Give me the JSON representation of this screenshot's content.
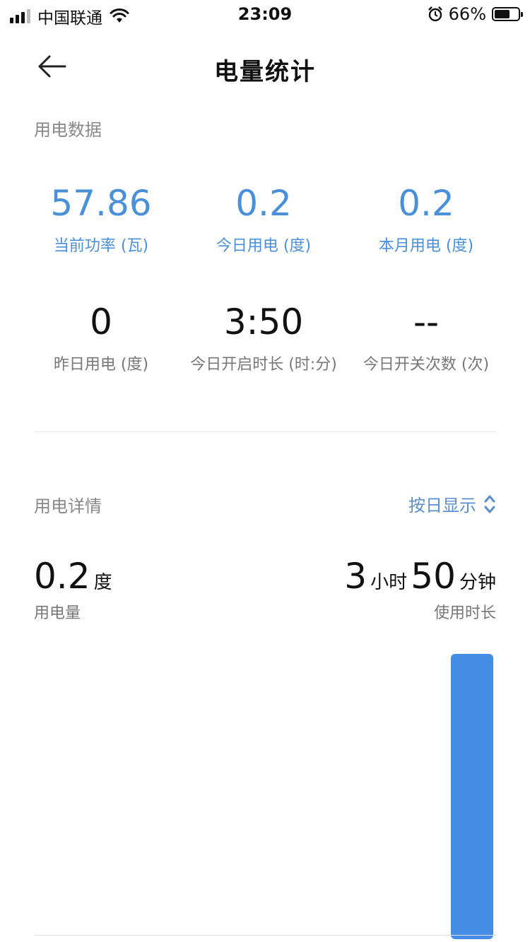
{
  "status_bar": {
    "carrier": "中国联通",
    "time": "23:09",
    "battery_percent": "66%",
    "battery_level": 0.66,
    "icons": [
      "signal-icon",
      "wifi-icon",
      "alarm-icon",
      "battery-icon"
    ]
  },
  "header": {
    "title": "电量统计",
    "back_icon": "arrow-left-icon"
  },
  "data_section": {
    "title": "用电数据",
    "stats": [
      {
        "value": "57.86",
        "label": "当前功率 (瓦)"
      },
      {
        "value": "0.2",
        "label": "今日用电 (度)"
      },
      {
        "value": "0.2",
        "label": "本月用电 (度)"
      },
      {
        "value": "0",
        "label": "昨日用电 (度)"
      },
      {
        "value": "3:50",
        "label": "今日开启时长 (时:分)"
      },
      {
        "value": "--",
        "label": "今日开关次数 (次)"
      }
    ]
  },
  "detail_section": {
    "title": "用电详情",
    "mode_toggle": "按日显示",
    "energy": {
      "value": "0.2",
      "unit": "度",
      "label": "用电量"
    },
    "duration": {
      "hours": "3",
      "hours_unit": "小时",
      "minutes": "50",
      "minutes_unit": "分钟",
      "label": "使用时长"
    }
  },
  "colors": {
    "accent": "#4a90d9",
    "bar": "#448ee5",
    "text_primary": "#111111",
    "text_secondary": "#777777"
  },
  "chart_data": {
    "type": "bar",
    "categories": [
      ""
    ],
    "values": [
      0.2
    ],
    "ylim": [
      0,
      0.2
    ],
    "grid": false
  }
}
